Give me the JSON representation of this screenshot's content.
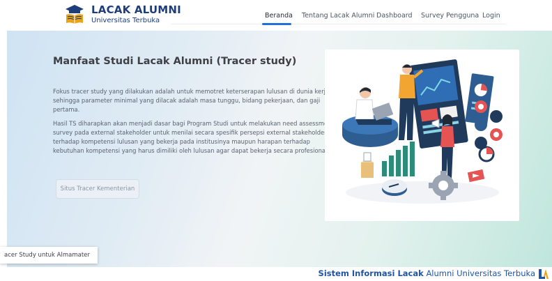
{
  "brand": {
    "title": "LACAK ALUMNI",
    "subtitle": "Universitas Terbuka"
  },
  "nav": {
    "items": [
      "Beranda",
      "Tentang Lacak Alumni",
      "Dashboard",
      "Survey Pengguna",
      "Login"
    ],
    "active_index": 0
  },
  "hero": {
    "title": "Manfaat Studi Lacak Alumni (Tracer study)",
    "paragraph1": "Fokus tracer study yang dilakukan adalah untuk memotret keterserapan lulusan di dunia kerja sehingga parameter minimal yang dilacak adalah masa tunggu, bidang pekerjaan, dan gaji pertama.",
    "paragraph2": "Hasil TS diharapkan akan menjadi dasar bagi Program Studi untuk melakukan need assessment survey pada external stakeholder untuk menilai secara spesifik persepsi external stakeholder terhadap kompetensi lulusan yang bekerja pada institusinya maupun harapan terhadap kebutuhan kompetensi yang harus dimiliki oleh lulusan agar dapat bekerja secara profesional.",
    "button_label": "Situs Tracer Kementerian"
  },
  "toast": {
    "text": "acer Study untuk Almamater"
  },
  "footer": {
    "strong": "Sistem Informasi Lacak",
    "rest": "Alumni Universitas Terbuka"
  },
  "colors": {
    "brand": "#1e3d7b",
    "accent": "#1f6fd6",
    "footer_text": "#2054a6"
  },
  "icons": [
    "graduation-book-logo",
    "data-analytics-illustration",
    "lacak-alumni-logo"
  ]
}
